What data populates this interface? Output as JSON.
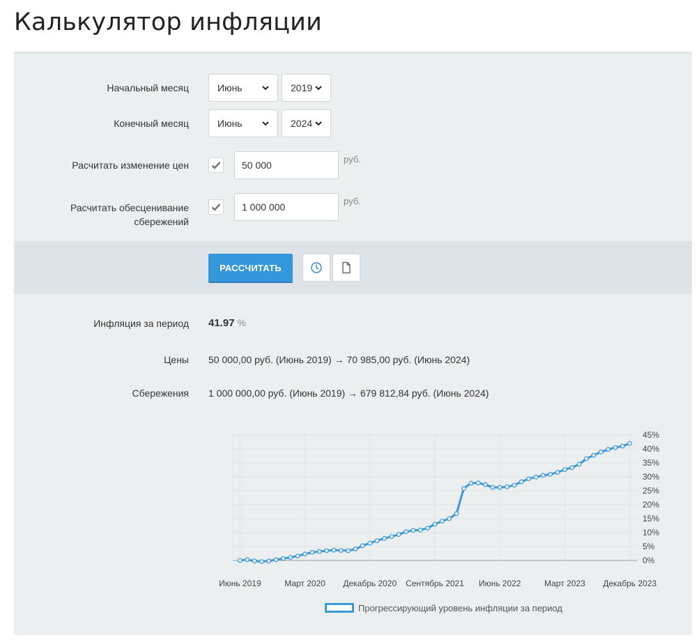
{
  "page": {
    "title": "Калькулятор инфляции"
  },
  "form": {
    "start_month": {
      "label": "Начальный месяц",
      "month": "Июнь",
      "year": "2019"
    },
    "end_month": {
      "label": "Конечный месяц",
      "month": "Июнь",
      "year": "2024"
    },
    "prices": {
      "label": "Расчитать изменение цен",
      "checked": true,
      "value": "50 000",
      "unit": "руб."
    },
    "savings": {
      "label_line1": "Расчитать обесценивание",
      "label_line2": "сбережений",
      "checked": true,
      "value": "1 000 000",
      "unit": "руб."
    }
  },
  "actions": {
    "calculate_label": "РАССЧИТАТЬ",
    "history_icon": "clock-icon",
    "document_icon": "document-icon"
  },
  "results": {
    "inflation": {
      "label": "Инфляция за период",
      "value": "41.97",
      "unit": "%"
    },
    "prices": {
      "label": "Цены",
      "value": "50 000,00 руб. (Июнь 2019) → 70 985,00 руб. (Июнь 2024)"
    },
    "savings": {
      "label": "Сбережения",
      "value": "1 000 000,00 руб. (Июнь 2019) → 679 812,84 руб. (Июнь 2024)"
    }
  },
  "colors": {
    "accent": "#3497db",
    "series": "#3a9ad8",
    "panel": "#ebeff0"
  },
  "chart_data": {
    "type": "line",
    "x_tick_labels": [
      "Июнь 2019",
      "Март 2020",
      "Декабрь 2020",
      "Сентябрь 2021",
      "Июнь 2022",
      "Март 2023",
      "Декабрь 2023"
    ],
    "y_tick_labels": [
      "0%",
      "5%",
      "10%",
      "15%",
      "20%",
      "25%",
      "30%",
      "35%",
      "40%",
      "45%"
    ],
    "ylim": [
      0,
      45
    ],
    "grid": true,
    "legend_position": "bottom",
    "series": [
      {
        "name": "Прогрессирующий уровень инфляции за период",
        "x_start": "Июнь 2019",
        "x_end": "Июнь 2024",
        "values": [
          0.0,
          0.3,
          -0.2,
          -0.4,
          -0.2,
          0.3,
          0.7,
          1.1,
          1.6,
          2.3,
          2.9,
          3.2,
          3.5,
          3.7,
          3.6,
          3.5,
          4.1,
          5.3,
          6.2,
          7.1,
          7.9,
          8.6,
          9.3,
          10.3,
          10.8,
          10.9,
          11.6,
          13.0,
          14.1,
          15.0,
          16.8,
          25.8,
          27.7,
          27.8,
          27.2,
          26.2,
          26.2,
          26.4,
          27.0,
          28.2,
          29.3,
          29.9,
          30.5,
          30.9,
          31.6,
          32.6,
          33.3,
          34.5,
          36.5,
          37.7,
          38.9,
          39.8,
          40.5,
          41.0,
          41.97
        ]
      }
    ]
  }
}
